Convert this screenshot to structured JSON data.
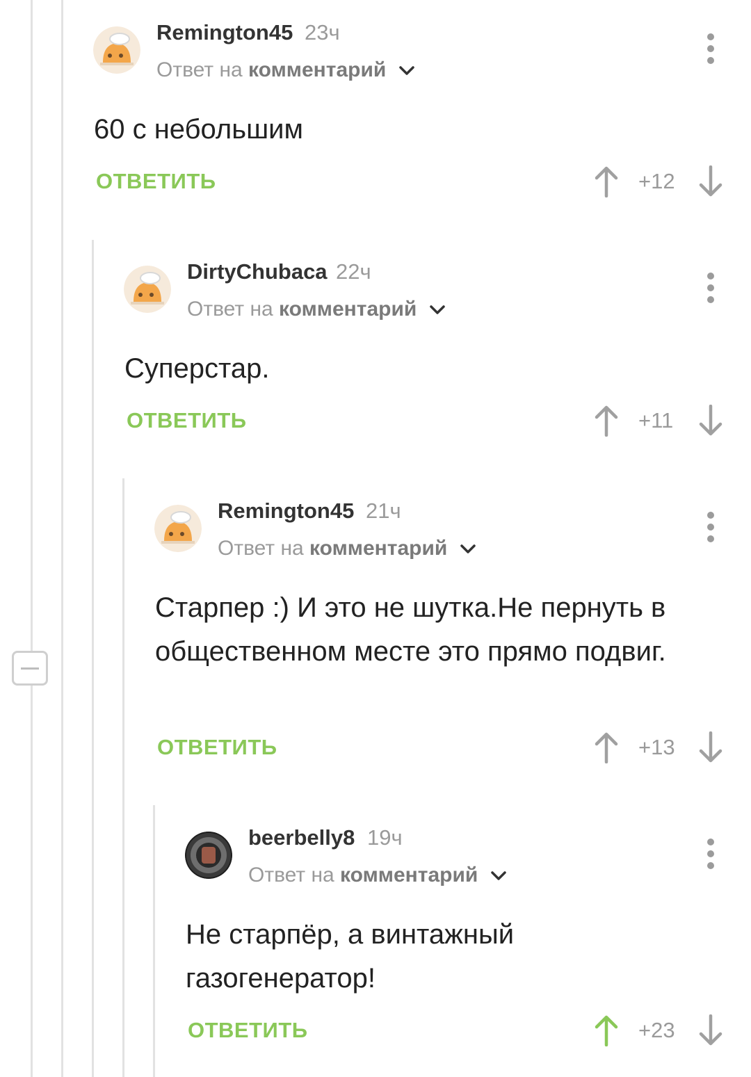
{
  "comments": [
    {
      "user": "Remington45",
      "time": "23ч",
      "reply_prefix": "Ответ на",
      "reply_target": "комментарий",
      "text": "60 с небольшим",
      "reply_label": "ОТВЕТИТЬ",
      "score": "+12",
      "upvoted": false
    },
    {
      "user": "DirtyChubaca",
      "time": "22ч",
      "reply_prefix": "Ответ на",
      "reply_target": "комментарий",
      "text": "Суперстар.",
      "reply_label": "ОТВЕТИТЬ",
      "score": "+11",
      "upvoted": false
    },
    {
      "user": "Remington45",
      "time": "21ч",
      "reply_prefix": "Ответ на",
      "reply_target": "комментарий",
      "text": "Старпер :) И это не шутка.Не пернуть в общественном месте это прямо подвиг.",
      "reply_label": "ОТВЕТИТЬ",
      "score": "+13",
      "upvoted": false
    },
    {
      "user": "beerbelly8",
      "time": "19ч",
      "reply_prefix": "Ответ на",
      "reply_target": "комментарий",
      "text": "Не старпёр, а винтажный газогенератор!",
      "reply_label": "ОТВЕТИТЬ",
      "score": "+23",
      "upvoted": true
    }
  ],
  "icons": {
    "menu": "more-vertical-icon",
    "upvote": "arrow-up-icon",
    "downvote": "arrow-down-icon",
    "collapse": "minus-icon",
    "reply_expand": "chevron-down-icon"
  },
  "colors": {
    "reply_green": "#8ac858",
    "upvote_active": "#8ac858",
    "vote_inactive": "#a0a0a0",
    "muted_text": "#9a9a9a"
  }
}
